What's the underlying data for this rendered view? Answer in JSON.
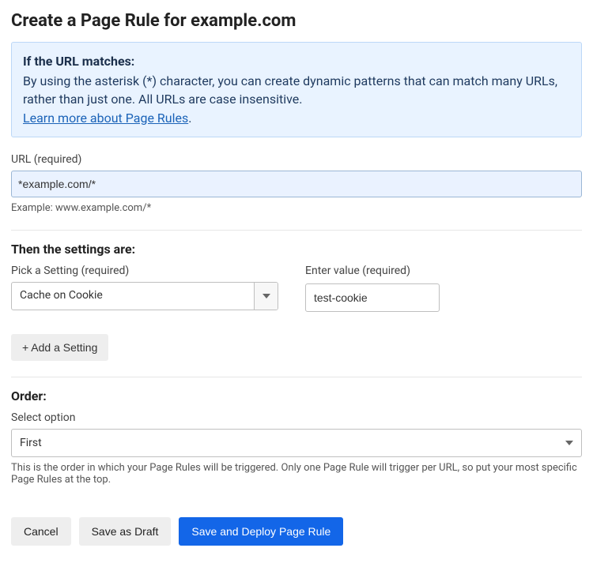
{
  "title": "Create a Page Rule for example.com",
  "info": {
    "heading": "If the URL matches:",
    "body": "By using the asterisk (*) character, you can create dynamic patterns that can match many URLs, rather than just one. All URLs are case insensitive.",
    "link_text": "Learn more about Page Rules"
  },
  "url_field": {
    "label": "URL (required)",
    "value": "*example.com/*",
    "example": "Example: www.example.com/*"
  },
  "settings": {
    "heading": "Then the settings are:",
    "pick_label": "Pick a Setting (required)",
    "selected_setting": "Cache on Cookie",
    "value_label": "Enter value (required)",
    "value": "test-cookie",
    "add_button": "+ Add a Setting"
  },
  "order": {
    "heading": "Order:",
    "select_label": "Select option",
    "selected": "First",
    "help": "This is the order in which your Page Rules will be triggered. Only one Page Rule will trigger per URL, so put your most specific Page Rules at the top."
  },
  "footer": {
    "cancel": "Cancel",
    "save_draft": "Save as Draft",
    "save_deploy": "Save and Deploy Page Rule"
  }
}
